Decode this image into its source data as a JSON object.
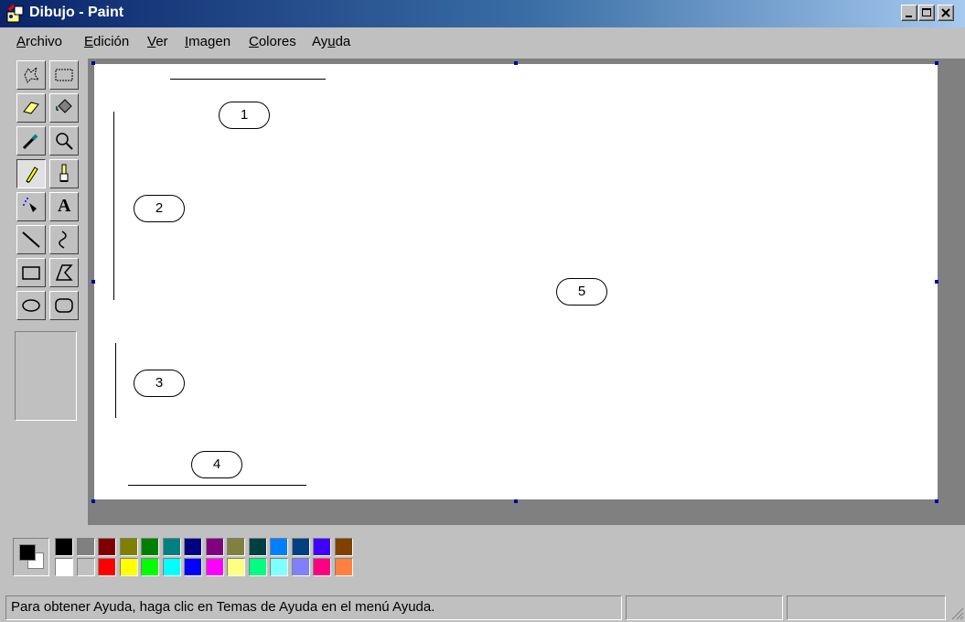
{
  "window": {
    "title": "Dibujo - Paint",
    "title_bar_color": "#0a246a"
  },
  "menu": [
    {
      "mnemonic": "A",
      "rest": "rchivo"
    },
    {
      "mnemonic": "E",
      "rest": "dición"
    },
    {
      "mnemonic": "V",
      "rest": "er"
    },
    {
      "mnemonic": "I",
      "rest": "magen"
    },
    {
      "mnemonic": "C",
      "rest": "olores"
    },
    {
      "pre": "Ay",
      "mnemonic": "u",
      "rest": "da"
    }
  ],
  "tools": [
    {
      "name": "free-select",
      "icon": "free-select-icon"
    },
    {
      "name": "rect-select",
      "icon": "rect-select-icon"
    },
    {
      "name": "eraser",
      "icon": "eraser-icon"
    },
    {
      "name": "fill",
      "icon": "paint-bucket-icon"
    },
    {
      "name": "pick-color",
      "icon": "eyedropper-icon"
    },
    {
      "name": "magnifier",
      "icon": "magnifier-icon"
    },
    {
      "name": "pencil",
      "icon": "pencil-icon",
      "active": true
    },
    {
      "name": "brush",
      "icon": "brush-icon"
    },
    {
      "name": "airbrush",
      "icon": "airbrush-icon"
    },
    {
      "name": "text",
      "icon": "text-icon",
      "glyph": "A"
    },
    {
      "name": "line",
      "icon": "line-icon"
    },
    {
      "name": "curve",
      "icon": "curve-icon"
    },
    {
      "name": "rectangle",
      "icon": "rectangle-icon"
    },
    {
      "name": "polygon",
      "icon": "polygon-icon"
    },
    {
      "name": "ellipse",
      "icon": "ellipse-icon"
    },
    {
      "name": "rounded-rectangle",
      "icon": "rounded-rectangle-icon"
    }
  ],
  "canvas": {
    "background": "#ffffff",
    "callouts": [
      "1",
      "2",
      "3",
      "4",
      "5"
    ]
  },
  "palette": {
    "foreground": "#000000",
    "background": "#ffffff",
    "top_row": [
      "#000000",
      "#808080",
      "#800000",
      "#808000",
      "#008000",
      "#008080",
      "#000080",
      "#800080",
      "#808040",
      "#004040",
      "#0080ff",
      "#004080",
      "#4000ff",
      "#804000"
    ],
    "bottom_row": [
      "#ffffff",
      "#c0c0c0",
      "#ff0000",
      "#ffff00",
      "#00ff00",
      "#00ffff",
      "#0000ff",
      "#ff00ff",
      "#ffff80",
      "#00ff80",
      "#80ffff",
      "#8080ff",
      "#ff0080",
      "#ff8040"
    ]
  },
  "status": {
    "text": "Para obtener Ayuda, haga clic en Temas de Ayuda en el menú Ayuda."
  }
}
